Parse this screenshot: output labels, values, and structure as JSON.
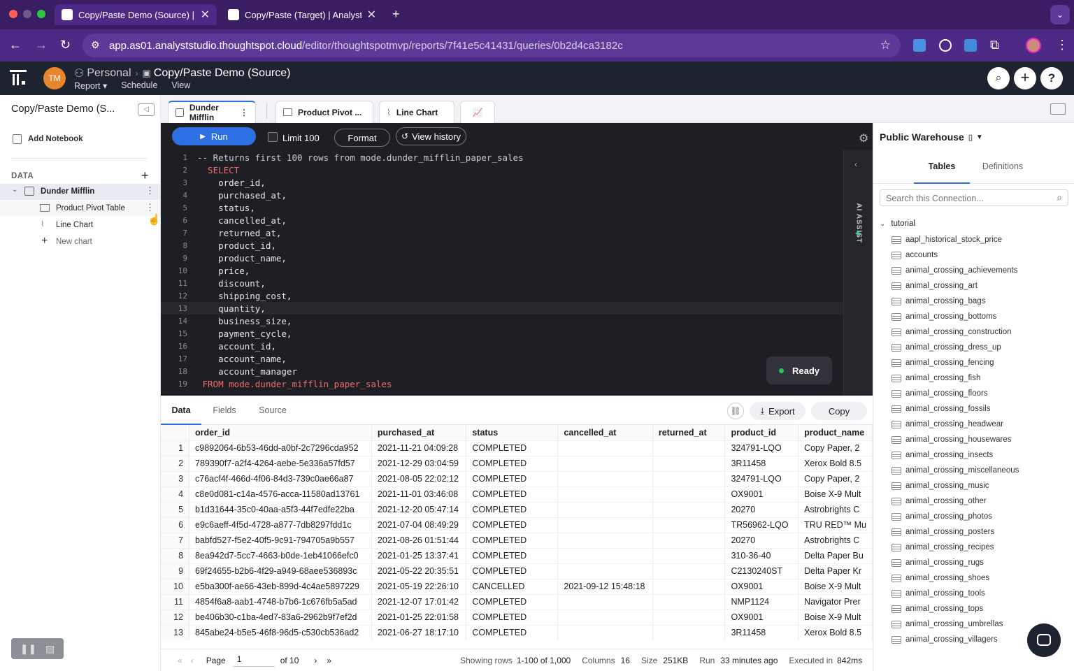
{
  "browser": {
    "tabs": [
      {
        "title": "Copy/Paste Demo (Source) | /"
      },
      {
        "title": "Copy/Paste (Target) | Analyst"
      }
    ],
    "new_tab": "+",
    "url_host": "app.as01.analyststudio.thoughtspot.cloud",
    "url_path": "/editor/thoughtspotmvp/reports/7f41e5c41431/queries/0b2d4ca3182c"
  },
  "app": {
    "avatar": "TM",
    "space": "Personal",
    "report_title": "Copy/Paste Demo (Source)",
    "menu": [
      "Report",
      "Schedule",
      "View"
    ]
  },
  "sidebar": {
    "title": "Copy/Paste Demo (S...",
    "add_notebook": "Add Notebook",
    "data_label": "DATA",
    "query": "Dunder Mifflin",
    "children": [
      "Product Pivot Table",
      "Line Chart"
    ],
    "new_chart": "New chart"
  },
  "editor_tabs": [
    "Dunder Mifflin",
    "Product Pivot ...",
    "Line Chart"
  ],
  "toolbar": {
    "run": "Run",
    "limit": "Limit 100",
    "format": "Format",
    "history": "View history"
  },
  "code": [
    "-- Returns first 100 rows from mode.dunder_mifflin_paper_sales",
    "  SELECT",
    "    order_id,",
    "    purchased_at,",
    "    status,",
    "    cancelled_at,",
    "    returned_at,",
    "    product_id,",
    "    product_name,",
    "    price,",
    "    discount,",
    "    shipping_cost,",
    "    quantity,",
    "    business_size,",
    "    payment_cycle,",
    "    account_id,",
    "    account_name,",
    "    account_manager",
    " FROM mode.dunder_mifflin_paper_sales"
  ],
  "ai_assist": "AI ASSIST",
  "ready": "Ready",
  "results": {
    "tabs": [
      "Data",
      "Fields",
      "Source"
    ],
    "export": "Export",
    "copy": "Copy",
    "columns": [
      "order_id",
      "purchased_at",
      "status",
      "cancelled_at",
      "returned_at",
      "product_id",
      "product_name"
    ],
    "rows": [
      [
        "1",
        "c9892064-6b53-46dd-a0bf-2c7296cda952",
        "2021-11-21 04:09:28",
        "COMPLETED",
        "",
        "",
        "324791-LQO",
        "Copy Paper, 2"
      ],
      [
        "2",
        "789390f7-a2f4-4264-aebe-5e336a57fd57",
        "2021-12-29 03:04:59",
        "COMPLETED",
        "",
        "",
        "3R11458",
        "Xerox Bold 8.5"
      ],
      [
        "3",
        "c76acf4f-466d-4f06-84d3-739c0ae66a87",
        "2021-08-05 22:02:12",
        "COMPLETED",
        "",
        "",
        "324791-LQO",
        "Copy Paper, 2"
      ],
      [
        "4",
        "c8e0d081-c14a-4576-acca-11580ad13761",
        "2021-11-01 03:46:08",
        "COMPLETED",
        "",
        "",
        "OX9001",
        "Boise X-9 Mult"
      ],
      [
        "5",
        "b1d31644-35c0-40aa-a5f3-44f7edfe22ba",
        "2021-12-20 05:47:14",
        "COMPLETED",
        "",
        "",
        "20270",
        "Astrobrights C"
      ],
      [
        "6",
        "e9c6aeff-4f5d-4728-a877-7db8297fdd1c",
        "2021-07-04 08:49:29",
        "COMPLETED",
        "",
        "",
        "TR56962-LQO",
        "TRU RED™ Mu"
      ],
      [
        "7",
        "babfd527-f5e2-40f5-9c91-794705a9b557",
        "2021-08-26 01:51:44",
        "COMPLETED",
        "",
        "",
        "20270",
        "Astrobrights C"
      ],
      [
        "8",
        "8ea942d7-5cc7-4663-b0de-1eb41066efc0",
        "2021-01-25 13:37:41",
        "COMPLETED",
        "",
        "",
        "310-36-40",
        "Delta Paper Bu"
      ],
      [
        "9",
        "69f24655-b2b6-4f29-a949-68aee536893c",
        "2021-05-22 20:35:51",
        "COMPLETED",
        "",
        "",
        "C2130240ST",
        "Delta Paper Kr"
      ],
      [
        "10",
        "e5ba300f-ae66-43eb-899d-4c4ae5897229",
        "2021-05-19 22:26:10",
        "CANCELLED",
        "2021-09-12 15:48:18",
        "",
        "OX9001",
        "Boise X-9 Mult"
      ],
      [
        "11",
        "4854f6a8-aab1-4748-b7b6-1c676fb5a5ad",
        "2021-12-07 17:01:42",
        "COMPLETED",
        "",
        "",
        "NMP1124",
        "Navigator Prer"
      ],
      [
        "12",
        "be406b30-c1ba-4ed7-83a6-2962b9f7ef2d",
        "2021-01-25 22:01:58",
        "COMPLETED",
        "",
        "",
        "OX9001",
        "Boise X-9 Mult"
      ],
      [
        "13",
        "845abe24-b5e5-46f8-96d5-c530cb536ad2",
        "2021-06-27 18:17:10",
        "COMPLETED",
        "",
        "",
        "3R11458",
        "Xerox Bold 8.5"
      ]
    ],
    "footer": {
      "page_label": "Page",
      "page_value": "1",
      "of": "of 10",
      "showing_label": "Showing rows",
      "showing_value": "1-100 of 1,000",
      "columns_label": "Columns",
      "columns_value": "16",
      "size_label": "Size",
      "size_value": "251KB",
      "run_label": "Run",
      "run_value": "33 minutes ago",
      "exec_label": "Executed in",
      "exec_value": "842ms"
    }
  },
  "right_panel": {
    "warehouse": "Public Warehouse",
    "tabs": [
      "Tables",
      "Definitions"
    ],
    "search_placeholder": "Search this Connection...",
    "schema": "tutorial",
    "tables": [
      "aapl_historical_stock_price",
      "accounts",
      "animal_crossing_achievements",
      "animal_crossing_art",
      "animal_crossing_bags",
      "animal_crossing_bottoms",
      "animal_crossing_construction",
      "animal_crossing_dress_up",
      "animal_crossing_fencing",
      "animal_crossing_fish",
      "animal_crossing_floors",
      "animal_crossing_fossils",
      "animal_crossing_headwear",
      "animal_crossing_housewares",
      "animal_crossing_insects",
      "animal_crossing_miscellaneous",
      "animal_crossing_music",
      "animal_crossing_other",
      "animal_crossing_photos",
      "animal_crossing_posters",
      "animal_crossing_recipes",
      "animal_crossing_rugs",
      "animal_crossing_shoes",
      "animal_crossing_tools",
      "animal_crossing_tops",
      "animal_crossing_umbrellas",
      "animal_crossing_villagers"
    ]
  },
  "colors": {
    "accent": "#2f6fe4",
    "browser_bg": "#3a1e63",
    "editor_bg": "#1e1f24",
    "keyword": "#f06b6b",
    "ready_dot": "#22c55e"
  }
}
